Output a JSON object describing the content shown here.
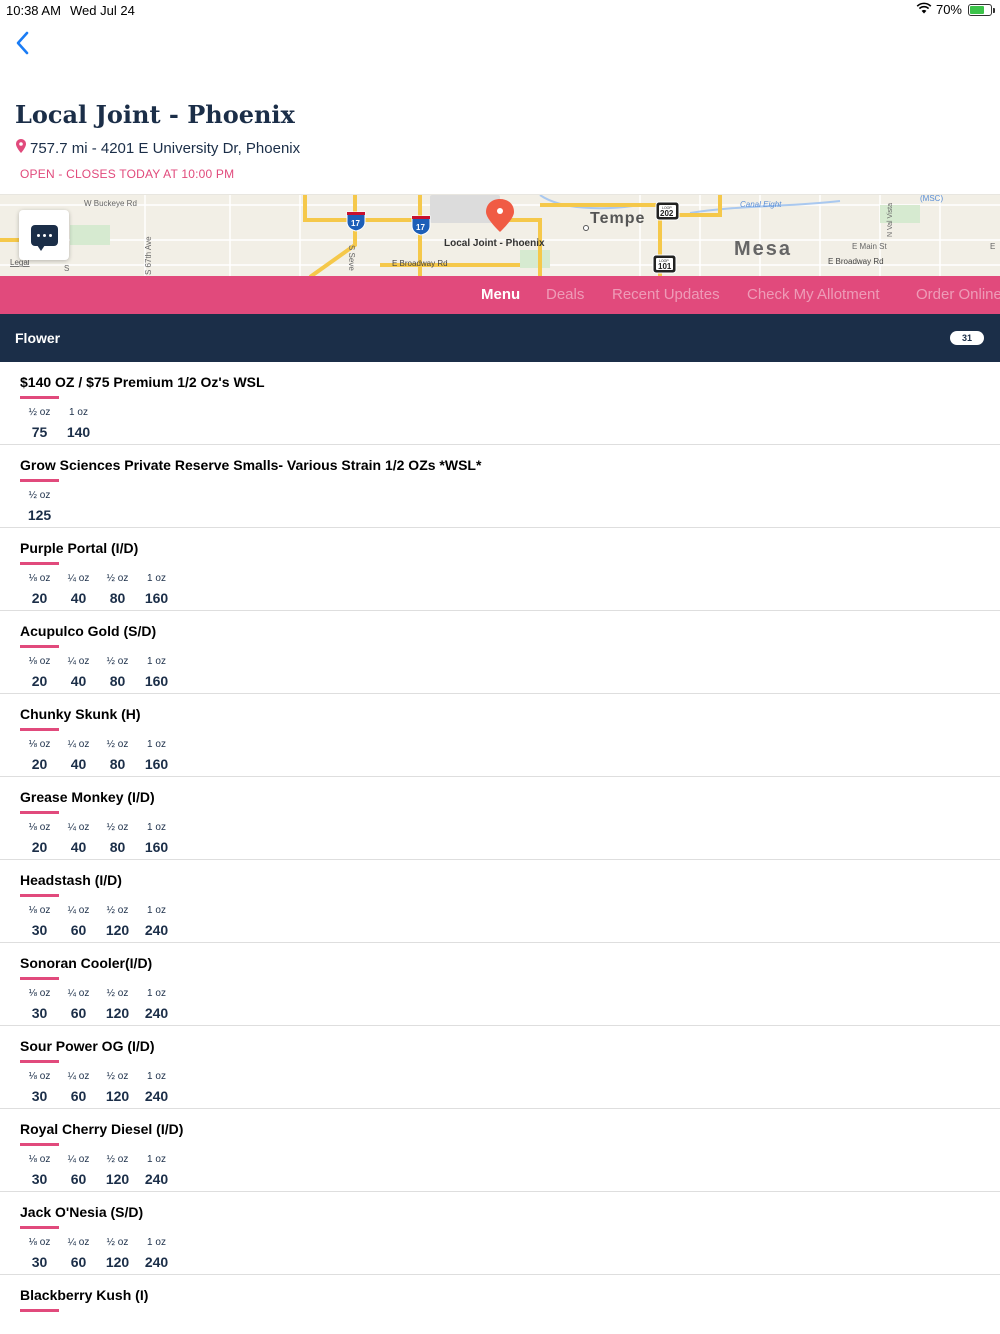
{
  "status_bar": {
    "time": "10:38 AM",
    "date": "Wed Jul 24",
    "battery": "70%",
    "battery_level": 0.7
  },
  "store": {
    "name": "Local Joint - Phoenix",
    "address": "757.7 mi - 4201 E University Dr, Phoenix",
    "hours": "OPEN - CLOSES TODAY AT 10:00 PM"
  },
  "map": {
    "labels": {
      "w_buckeye": "W Buckeye Rd",
      "s_67th": "S 67th Ave",
      "legal": "Legal",
      "s_seventh": "S Seve",
      "local_joint": "Local Joint - Phoenix",
      "e_broadway": "E Broadway Rd",
      "tempe": "Tempe",
      "canal_eight": "Canal Eight",
      "mesa": "Mesa",
      "n_val_vista": "N Val Vista",
      "msc": "(MSC)",
      "e_main": "E Main St",
      "e_broadway_2": "E Broadway Rd",
      "i17_a": "17",
      "i17_b": "17",
      "loop202": "202",
      "loop101": "101",
      "loop_word": "LOOP",
      "e_letter": "E",
      "s_letter": "S"
    }
  },
  "tabs": [
    "Menu",
    "Deals",
    "Recent Updates",
    "Check My Allotment",
    "Order Online"
  ],
  "category": {
    "name": "Flower",
    "count": "31"
  },
  "products": [
    {
      "name": "$140 OZ / $75 Premium 1/2 Oz's WSL",
      "prices": [
        {
          "unit": "½ oz",
          "amount": "75"
        },
        {
          "unit": "1 oz",
          "amount": "140"
        }
      ]
    },
    {
      "name": "Grow Sciences Private Reserve Smalls- Various Strain 1/2 OZs *WSL*",
      "prices": [
        {
          "unit": "½ oz",
          "amount": "125"
        }
      ]
    },
    {
      "name": "Purple Portal (I/D)",
      "prices": [
        {
          "unit": "⅛ oz",
          "amount": "20"
        },
        {
          "unit": "¼ oz",
          "amount": "40"
        },
        {
          "unit": "½ oz",
          "amount": "80"
        },
        {
          "unit": "1 oz",
          "amount": "160"
        }
      ]
    },
    {
      "name": "Acupulco Gold (S/D)",
      "prices": [
        {
          "unit": "⅛ oz",
          "amount": "20"
        },
        {
          "unit": "¼ oz",
          "amount": "40"
        },
        {
          "unit": "½ oz",
          "amount": "80"
        },
        {
          "unit": "1 oz",
          "amount": "160"
        }
      ]
    },
    {
      "name": "Chunky Skunk (H)",
      "prices": [
        {
          "unit": "⅛ oz",
          "amount": "20"
        },
        {
          "unit": "¼ oz",
          "amount": "40"
        },
        {
          "unit": "½ oz",
          "amount": "80"
        },
        {
          "unit": "1 oz",
          "amount": "160"
        }
      ]
    },
    {
      "name": "Grease Monkey (I/D)",
      "prices": [
        {
          "unit": "⅛ oz",
          "amount": "20"
        },
        {
          "unit": "¼ oz",
          "amount": "40"
        },
        {
          "unit": "½ oz",
          "amount": "80"
        },
        {
          "unit": "1 oz",
          "amount": "160"
        }
      ]
    },
    {
      "name": "Headstash (I/D)",
      "prices": [
        {
          "unit": "⅛ oz",
          "amount": "30"
        },
        {
          "unit": "¼ oz",
          "amount": "60"
        },
        {
          "unit": "½ oz",
          "amount": "120"
        },
        {
          "unit": "1 oz",
          "amount": "240"
        }
      ]
    },
    {
      "name": "Sonoran Cooler(I/D)",
      "prices": [
        {
          "unit": "⅛ oz",
          "amount": "30"
        },
        {
          "unit": "¼ oz",
          "amount": "60"
        },
        {
          "unit": "½ oz",
          "amount": "120"
        },
        {
          "unit": "1 oz",
          "amount": "240"
        }
      ]
    },
    {
      "name": "Sour Power OG (I/D)",
      "prices": [
        {
          "unit": "⅛ oz",
          "amount": "30"
        },
        {
          "unit": "¼ oz",
          "amount": "60"
        },
        {
          "unit": "½ oz",
          "amount": "120"
        },
        {
          "unit": "1 oz",
          "amount": "240"
        }
      ]
    },
    {
      "name": "Royal Cherry Diesel (I/D)",
      "prices": [
        {
          "unit": "⅛ oz",
          "amount": "30"
        },
        {
          "unit": "¼ oz",
          "amount": "60"
        },
        {
          "unit": "½ oz",
          "amount": "120"
        },
        {
          "unit": "1 oz",
          "amount": "240"
        }
      ]
    },
    {
      "name": "Jack O'Nesia (S/D)",
      "prices": [
        {
          "unit": "⅛ oz",
          "amount": "30"
        },
        {
          "unit": "¼ oz",
          "amount": "60"
        },
        {
          "unit": "½ oz",
          "amount": "120"
        },
        {
          "unit": "1 oz",
          "amount": "240"
        }
      ]
    },
    {
      "name": "Blackberry Kush (I)",
      "prices": []
    }
  ],
  "colors": {
    "accent": "#e14a7c",
    "navy": "#1b2e48",
    "ios_blue": "#1a7cf5"
  },
  "icons": {
    "back": "chevron-left-icon",
    "location": "map-pin-icon",
    "chat": "chat-icon",
    "wifi": "wifi-icon",
    "battery": "battery-icon"
  }
}
